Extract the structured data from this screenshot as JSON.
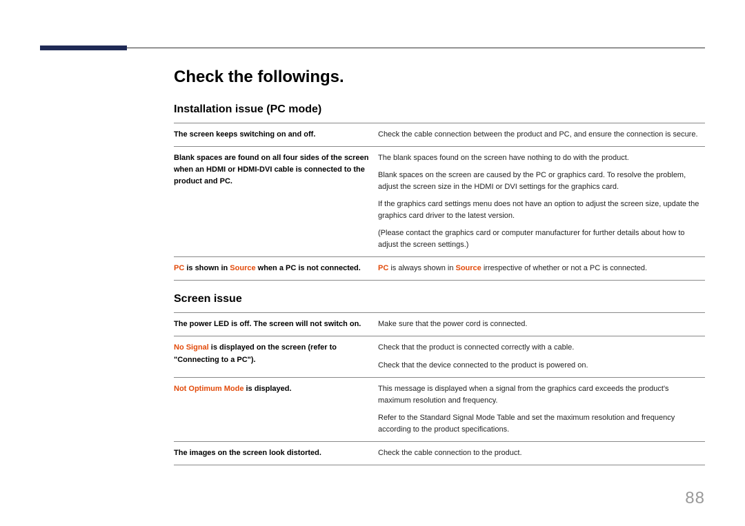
{
  "page_number": "88",
  "main_title": "Check the followings.",
  "sections": [
    {
      "heading": "Installation issue (PC mode)",
      "rows": [
        {
          "left": [
            {
              "runs": [
                {
                  "text": "The screen keeps switching on and off."
                }
              ]
            }
          ],
          "right": [
            {
              "runs": [
                {
                  "text": "Check the cable connection between the product and PC, and ensure the connection is secure."
                }
              ]
            }
          ]
        },
        {
          "left": [
            {
              "runs": [
                {
                  "text": "Blank spaces are found on all four sides of the screen when an HDMI or HDMI-DVI cable is connected to the product and PC."
                }
              ]
            }
          ],
          "right": [
            {
              "runs": [
                {
                  "text": "The blank spaces found on the screen have nothing to do with the product."
                }
              ]
            },
            {
              "runs": [
                {
                  "text": "Blank spaces on the screen are caused by the PC or graphics card. To resolve the problem, adjust the screen size in the HDMI or DVI settings for the graphics card."
                }
              ]
            },
            {
              "runs": [
                {
                  "text": "If the graphics card settings menu does not have an option to adjust the screen size, update the graphics card driver to the latest version."
                }
              ]
            },
            {
              "runs": [
                {
                  "text": "(Please contact the graphics card or computer manufacturer for further details about how to adjust the screen settings.)"
                }
              ]
            }
          ]
        },
        {
          "left": [
            {
              "runs": [
                {
                  "text": "PC",
                  "hl": true
                },
                {
                  "text": " is shown in "
                },
                {
                  "text": "Source",
                  "hl": true
                },
                {
                  "text": " when a PC is not connected."
                }
              ]
            }
          ],
          "right": [
            {
              "runs": [
                {
                  "text": "PC",
                  "hl": true,
                  "bold": true
                },
                {
                  "text": " is always shown in "
                },
                {
                  "text": "Source",
                  "hl": true,
                  "bold": true
                },
                {
                  "text": " irrespective of whether or not a PC is connected."
                }
              ]
            }
          ]
        }
      ]
    },
    {
      "heading": "Screen issue",
      "rows": [
        {
          "left": [
            {
              "runs": [
                {
                  "text": "The power LED is off. The screen will not switch on."
                }
              ]
            }
          ],
          "right": [
            {
              "runs": [
                {
                  "text": "Make sure that the power cord is connected."
                }
              ]
            }
          ]
        },
        {
          "left": [
            {
              "runs": [
                {
                  "text": "No Signal",
                  "hl": true
                },
                {
                  "text": " is displayed on the screen (refer to \"Connecting to a PC\")."
                }
              ]
            }
          ],
          "right": [
            {
              "runs": [
                {
                  "text": "Check that the product is connected correctly with a cable."
                }
              ]
            },
            {
              "runs": [
                {
                  "text": "Check that the device connected to the product is powered on."
                }
              ]
            }
          ]
        },
        {
          "left": [
            {
              "runs": [
                {
                  "text": "Not Optimum Mode",
                  "hl": true
                },
                {
                  "text": " is displayed."
                }
              ]
            }
          ],
          "right": [
            {
              "runs": [
                {
                  "text": "This message is displayed when a signal from the graphics card exceeds the product's maximum resolution and frequency."
                }
              ]
            },
            {
              "runs": [
                {
                  "text": "Refer to the Standard Signal Mode Table and set the maximum resolution and frequency according to the product specifications."
                }
              ]
            }
          ]
        },
        {
          "left": [
            {
              "runs": [
                {
                  "text": "The images on the screen look distorted."
                }
              ]
            }
          ],
          "right": [
            {
              "runs": [
                {
                  "text": "Check the cable connection to the product."
                }
              ]
            }
          ]
        }
      ]
    }
  ]
}
